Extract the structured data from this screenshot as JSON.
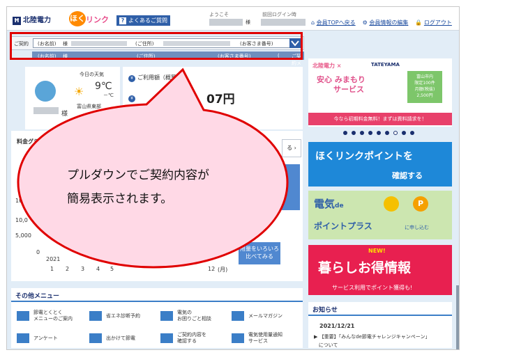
{
  "header": {
    "company": "北陸電力",
    "app_name_a": "ほく",
    "app_name_b": "リンク",
    "faq": "よくあるご質問",
    "welcome_label": "ようこそ",
    "sama": "様",
    "last_login_label": "前回ログイン時",
    "links": [
      "会員TOPへ戻る",
      "会員情報の編集",
      "ログアウト"
    ]
  },
  "contract": {
    "label": "ご契約",
    "select_name": "(お名前)",
    "select_sama": "様",
    "select_address": "(ご住所)",
    "select_customer_no": "(お客さま番号)",
    "dropdown_name": "(お名前)",
    "dropdown_sama": "様",
    "dropdown_address": "(ご住所)",
    "dropdown_customer_no": "(お客さま番号)",
    "dropdown_menu": "ご契約メニュー"
  },
  "profile": {
    "weather_label": "今日の天気",
    "temp_high": "9℃",
    "temp_low": "－℃",
    "region": "富山県東部",
    "sama": "様"
  },
  "bill": {
    "label": "ご利用額（概算",
    "amount_suffix": "07円"
  },
  "chart_data": {
    "type": "bar",
    "title": "料金グラ",
    "categories": [
      "1",
      "2",
      "3",
      "4",
      "5",
      "12"
    ],
    "values": [],
    "ylabels": [
      "10,0",
      "10,0",
      "5,000",
      "0"
    ],
    "year": "2021",
    "x_unit": "(月)",
    "see_more": "る",
    "compare_btn_lines": [
      "用量をいろいろ",
      "比べてみる"
    ]
  },
  "other_menu": {
    "title": "その他メニュー",
    "items": [
      "節電とくとく\nメニューのご案内",
      "省エネ診断予約",
      "電気の\nお困りごと相談",
      "メールマガジン",
      "アンケート",
      "出かけて節電",
      "ご契約内容を\n確認する",
      "電気使用量通知\nサービス"
    ]
  },
  "banners": {
    "hokuriku_title": "北陸電力 ×",
    "tateyama": "TATEYAMA",
    "mimamori_a": "安心",
    "mimamori_b": "みまもり",
    "mimamori_c": "サービス",
    "badge": "富山市内\n限定100件\n月額(税抜)\n2,500円",
    "cta": "今なら初期料金無料！まずは資料請求を！",
    "point_main": "ほくリンクポイントを",
    "point_sub": "確認する",
    "plus_1": "電気",
    "plus_de": "de",
    "plus_2": "ポイントプラス",
    "plus_3": "に申し込む",
    "plus_coin": "P",
    "kurashi_new": "NEW!",
    "kurashi_main": "暮らしお得情報",
    "kurashi_sub": "サービス利用でポイント獲得も!"
  },
  "news": {
    "title": "お知らせ",
    "date": "2021/12/21",
    "item_line1": "【重要】「みんなde節電チャレンジキャンペーン」",
    "item_line2": "について"
  },
  "callout": {
    "line1": "プルダウンでご契約内容が",
    "line2": "簡易表示されます。"
  },
  "colors": {
    "accent": "#e00000",
    "brand_blue": "#2f5fa8",
    "bubble_fill": "#ffd9e6"
  }
}
